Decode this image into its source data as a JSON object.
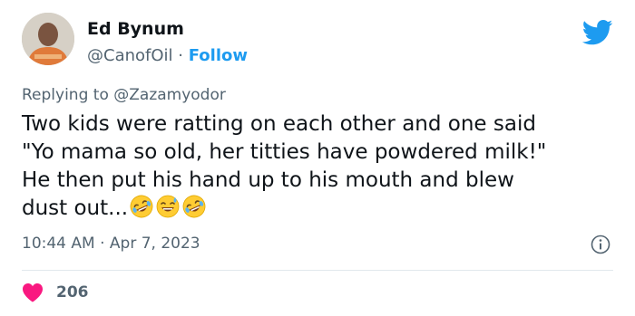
{
  "tweet": {
    "author": {
      "name": "Ed Bynum",
      "handle": "@CanofOil",
      "separator": "·",
      "follow_label": "Follow"
    },
    "replying_prefix": "Replying to",
    "replying_to": "@Zazamyodor",
    "text": "Two kids were ratting on each other and one said\n\"Yo mama so old, her titties have powdered milk!\"\nHe then put his hand up to his mouth and blew\ndust out...",
    "emojis": [
      "rolling-on-floor-laughing-icon",
      "grinning-sweat-icon",
      "rolling-on-floor-laughing-icon"
    ],
    "time": "10:44 AM",
    "date_separator": "·",
    "date": "Apr 7, 2023",
    "likes": "206"
  },
  "colors": {
    "accent": "#1d9bf0",
    "heart": "#f91880",
    "muted": "#536471",
    "text": "#0f1419"
  }
}
